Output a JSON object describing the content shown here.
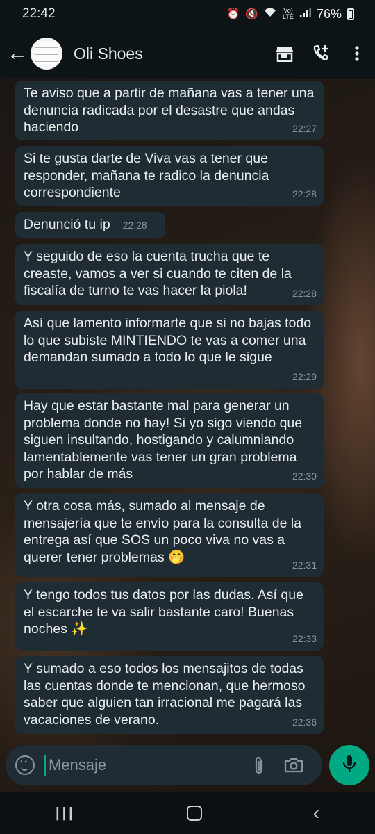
{
  "status_bar": {
    "time": "22:42",
    "network": "Vo) LTE",
    "battery": "76%"
  },
  "header": {
    "back_icon": "arrow-left-icon",
    "contact_name": "Oli Shoes",
    "icons": [
      "shop-icon",
      "add-call-icon",
      "more-vert-icon"
    ]
  },
  "messages": [
    {
      "text": "Te aviso que a partir de mañana vas a tener una denuncia radicada por el desastre que andas haciendo",
      "time": "22:27"
    },
    {
      "text": "Si te gusta darte de Viva vas a tener que responder, mañana te radico la denuncia correspondiente",
      "time": "22:28"
    },
    {
      "text": "Denunció tu ip",
      "time": "22:28"
    },
    {
      "text": "Y seguido de eso la cuenta trucha que te creaste, vamos a ver si cuando te citen de la fiscalía de turno te vas hacer la piola!",
      "time": "22:28"
    },
    {
      "text": "Así que lamento informarte que si no bajas todo lo que subiste MINTIENDO te vas a comer una demandan sumado a todo lo que le sigue",
      "time": "22:29"
    },
    {
      "text": "Hay que estar bastante mal para generar un problema donde no hay! Si yo sigo viendo que siguen insultando, hostigando y calumniando lamentablemente vas  tener un gran problema por hablar de más",
      "time": "22:30"
    },
    {
      "text": "Y otra cosa más, sumado al mensaje de mensajería que te envío para la consulta de la entrega así que  SOS un poco viva no vas a querer tener problemas 🤭",
      "time": "22:31"
    },
    {
      "text": "Y tengo todos tus datos por las dudas. Así que el escarche te va salir bastante caro! Buenas noches ✨",
      "time": "22:33"
    },
    {
      "text": "Y sumado a eso todos los mensajitos de todas las cuentas donde te mencionan, que hermoso saber que alguien tan irracional me pagará las vacaciones de verano.",
      "time": "22:36"
    }
  ],
  "composer": {
    "placeholder": "Mensaje",
    "icons": [
      "emoji-icon",
      "attach-icon",
      "camera-icon",
      "mic-icon"
    ]
  },
  "colors": {
    "bubble": "#1f2c34",
    "accent": "#00a884",
    "timestamp": "#8696a0"
  }
}
